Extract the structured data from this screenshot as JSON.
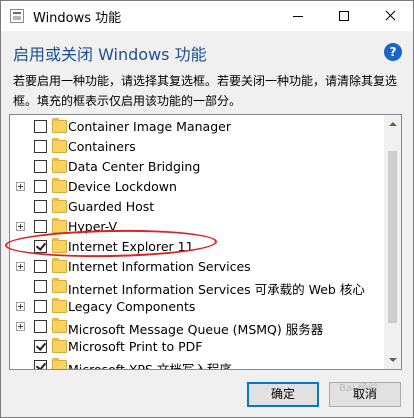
{
  "window": {
    "title": "Windows 功能",
    "heading": "启用或关闭 Windows 功能",
    "description": "若要启用一种功能，请选择其复选框。若要关闭一种功能，请清除其复选框。填充的框表示仅启用该功能的一部分。",
    "help_symbol": "?"
  },
  "features": [
    {
      "label": "Container Image Manager",
      "checked": false,
      "expandable": false
    },
    {
      "label": "Containers",
      "checked": false,
      "expandable": false
    },
    {
      "label": "Data Center Bridging",
      "checked": false,
      "expandable": false
    },
    {
      "label": "Device Lockdown",
      "checked": false,
      "expandable": true
    },
    {
      "label": "Guarded Host",
      "checked": false,
      "expandable": false
    },
    {
      "label": "Hyper-V",
      "checked": false,
      "expandable": true
    },
    {
      "label": "Internet Explorer 11",
      "checked": true,
      "expandable": false
    },
    {
      "label": "Internet Information Services",
      "checked": false,
      "expandable": true
    },
    {
      "label": "Internet Information Services 可承载的 Web 核心",
      "checked": false,
      "expandable": false
    },
    {
      "label": "Legacy Components",
      "checked": false,
      "expandable": true
    },
    {
      "label": "Microsoft Message Queue (MSMQ) 服务器",
      "checked": false,
      "expandable": true
    },
    {
      "label": "Microsoft Print to PDF",
      "checked": true,
      "expandable": false
    },
    {
      "label": "Microsoft XPS 文档写入程序",
      "checked": true,
      "expandable": false
    }
  ],
  "buttons": {
    "ok": "确定",
    "cancel": "取消"
  },
  "watermark": "Bai 经验",
  "colors": {
    "heading": "#1d4f91",
    "annotation": "#e02020",
    "folder": "#f7d360"
  }
}
